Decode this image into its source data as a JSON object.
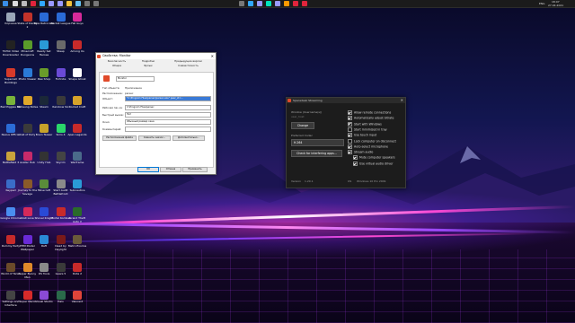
{
  "taskbar": {
    "time": "18:07",
    "date": "27.04.2021",
    "lang": "ENG",
    "colors": {
      "bg": "#1b1b1b"
    },
    "pinned": [
      {
        "name": "search-icon",
        "color": "#dddddd"
      },
      {
        "name": "task-view-icon",
        "color": "#bbbbbb"
      },
      {
        "name": "opera-icon",
        "color": "#e0243c"
      },
      {
        "name": "photoshop-icon",
        "color": "#31a8ff"
      },
      {
        "name": "premiere-icon",
        "color": "#9999ff"
      },
      {
        "name": "after-effects-icon",
        "color": "#9999ff"
      },
      {
        "name": "explorer-icon",
        "color": "#f3c13a"
      },
      {
        "name": "steam-icon",
        "color": "#66c0f4"
      },
      {
        "name": "app-icon",
        "color": "#777777"
      },
      {
        "name": "app-icon",
        "color": "#777777"
      }
    ],
    "center": [
      {
        "name": "app-icon",
        "color": "#777777"
      },
      {
        "name": "photoshop-icon",
        "color": "#31a8ff"
      },
      {
        "name": "premiere-icon",
        "color": "#9999ff"
      },
      {
        "name": "audition-icon",
        "color": "#00e4bb"
      },
      {
        "name": "after-effects-icon",
        "color": "#9999ff"
      },
      {
        "name": "illustrator-icon",
        "color": "#ff9a00"
      },
      {
        "name": "adobe-icon",
        "color": "#e0243c"
      },
      {
        "name": "opera-icon",
        "color": "#e0243c"
      }
    ]
  },
  "desktop": {
    "icons": [
      {
        "label": "Корзина",
        "color": "#9aa6b8"
      },
      {
        "label": "TikTok Video Downloader",
        "color": "#222222"
      },
      {
        "label": "Supercell Buildings",
        "color": "#d63a2a"
      },
      {
        "label": "Bad Piggies HD",
        "color": "#79b33a"
      },
      {
        "label": "Nexus Official",
        "color": "#2b6cd6"
      },
      {
        "label": "Battlefield 3",
        "color": "#c9a23c"
      },
      {
        "label": "Keypad",
        "color": "#3a6cc8"
      },
      {
        "label": "Google Chrome",
        "color": "#4a8df0"
      },
      {
        "label": "Rummy Party",
        "color": "#c72a2a"
      },
      {
        "label": "World of Tanks",
        "color": "#6b4a2a"
      },
      {
        "label": "Settings and Interface",
        "color": "#444444"
      },
      {
        "label": "State of Decay 2",
        "color": "#c2332a"
      },
      {
        "label": "Minecraft Dungeons",
        "color": "#5a9c2a"
      },
      {
        "label": "Photo Viewer",
        "color": "#2a7ad6"
      },
      {
        "label": "Samsung Notes",
        "color": "#e0a82a"
      },
      {
        "label": "Call of Duty",
        "color": "#3a3a3a"
      },
      {
        "label": "Avatar Hub",
        "color": "#c72a6a"
      },
      {
        "label": "Journey to the Savage",
        "color": "#8a5a2a"
      },
      {
        "label": "Visit Love",
        "color": "#d62a5a"
      },
      {
        "label": "PHM Poster Wallpaper",
        "color": "#6a2ad6"
      },
      {
        "label": "Super Bunny Man",
        "color": "#e08a2a"
      },
      {
        "label": "Super Mario",
        "color": "#d62a2a"
      },
      {
        "label": "Blue Retrocade",
        "color": "#2a6ad6"
      },
      {
        "label": "Ready Set Heroes",
        "color": "#2a9ad6"
      },
      {
        "label": "Paw Shop",
        "color": "#6a9c2a"
      },
      {
        "label": "Steam",
        "color": "#1b2838"
      },
      {
        "label": "Brain Teaser",
        "color": "#c7a22a"
      },
      {
        "label": "Unity Hub",
        "color": "#333333"
      },
      {
        "label": "Minecraft",
        "color": "#5a8c3a"
      },
      {
        "label": "Shovel Knight",
        "color": "#2a4ad6"
      },
      {
        "label": "Raft",
        "color": "#2a8ad6"
      },
      {
        "label": "DS Tools",
        "color": "#8a8a8a"
      },
      {
        "label": "Visual Studio",
        "color": "#8a4ad6"
      },
      {
        "label": "Rocket League",
        "color": "#2a6ad6"
      },
      {
        "label": "Steep",
        "color": "#6a6a6a"
      },
      {
        "label": "Fortnite",
        "color": "#6a4ad6"
      },
      {
        "label": "Rainbow Six",
        "color": "#3a3a3a"
      },
      {
        "label": "Sims 4",
        "color": "#2ad66a"
      },
      {
        "label": "Skyrim",
        "color": "#444444"
      },
      {
        "label": "Start Audit Battlefront",
        "color": "#8a8a8a"
      },
      {
        "label": "Mortal Kombat",
        "color": "#c72a2a"
      },
      {
        "label": "Dead by Daylight",
        "color": "#7a1a1a"
      },
      {
        "label": "Gears 5",
        "color": "#3a3a3a"
      },
      {
        "label": "Halo",
        "color": "#2a6a4a"
      },
      {
        "label": "Fall Guys",
        "color": "#d62a9a"
      },
      {
        "label": "Among Us",
        "color": "#c72a2a"
      },
      {
        "label": "Shape Ghost",
        "color": "#ffffff"
      },
      {
        "label": "Rocket Craft",
        "color": "#d6a22a"
      },
      {
        "label": "Apex Legends",
        "color": "#c72a2a"
      },
      {
        "label": "Warframe",
        "color": "#4a6a8a"
      },
      {
        "label": "Subnautica",
        "color": "#2a9ad6"
      },
      {
        "label": "Grand Theft Auto V",
        "color": "#2a6a2a"
      },
      {
        "label": "Metro Exodus",
        "color": "#6a5a3a"
      },
      {
        "label": "Dota 2",
        "color": "#c72a2a"
      },
      {
        "label": "Valorant",
        "color": "#e0443a"
      }
    ]
  },
  "properties_dialog": {
    "title": "Свойства: Monitor",
    "tabs_row1": [
      "Безопасность",
      "Подробно",
      "Предыдущие версии"
    ],
    "tabs_row2": [
      "Общие",
      "Ярлык",
      "Совместимость"
    ],
    "app_name": "Monitor",
    "type_label": "Тип объекта:",
    "type_value": "Приложение",
    "location_label": "Расположение:",
    "location_value": "parsec",
    "object_label": "Объект:",
    "object_value": "\"C:\\Program Files\\parsec\\parsec.exe\" peer_id=...",
    "workdir_label": "Рабочая папка:",
    "workdir_value": "C:\\Program Files\\parsec",
    "hotkey_label": "Быстрый вызов:",
    "hotkey_value": "Нет",
    "window_label": "Окно:",
    "window_value": "Обычный размер окна",
    "comment_label": "Комментарий:",
    "btn_location": "Расположение файла",
    "btn_icon": "Сменить значок...",
    "btn_advanced": "Дополнительно...",
    "btn_ok": "ОК",
    "btn_cancel": "Отмена",
    "btn_apply": "Применить"
  },
  "stream_window": {
    "title": "Spacedesk Streaming",
    "window_label": "Window (Username(s))",
    "window_value": "user_host",
    "change_btn": "Change",
    "codec_label": "Preferred Codec",
    "codec_value": "H.264",
    "check_btn": "Check for interfering apps...",
    "version_label": "Version",
    "version_value": "1.20.1",
    "os_label": "OS",
    "os_value": "Windows 10 Pro 2009",
    "options": [
      {
        "label": "Allow remote connections",
        "checked": true
      },
      {
        "label": "Automatically adjust bitrate",
        "checked": true
      },
      {
        "label": "Start with Windows",
        "checked": true
      },
      {
        "label": "Start minimized in tray",
        "checked": false
      },
      {
        "label": "Use touch input",
        "checked": true
      },
      {
        "label": "Lock computer on disconnect",
        "checked": false
      },
      {
        "label": "Auto-select microphone",
        "checked": true
      },
      {
        "label": "Stream audio",
        "checked": true
      },
      {
        "label": "Mute computer speakers",
        "checked": true
      },
      {
        "label": "Use virtual audio driver",
        "checked": true
      }
    ]
  }
}
